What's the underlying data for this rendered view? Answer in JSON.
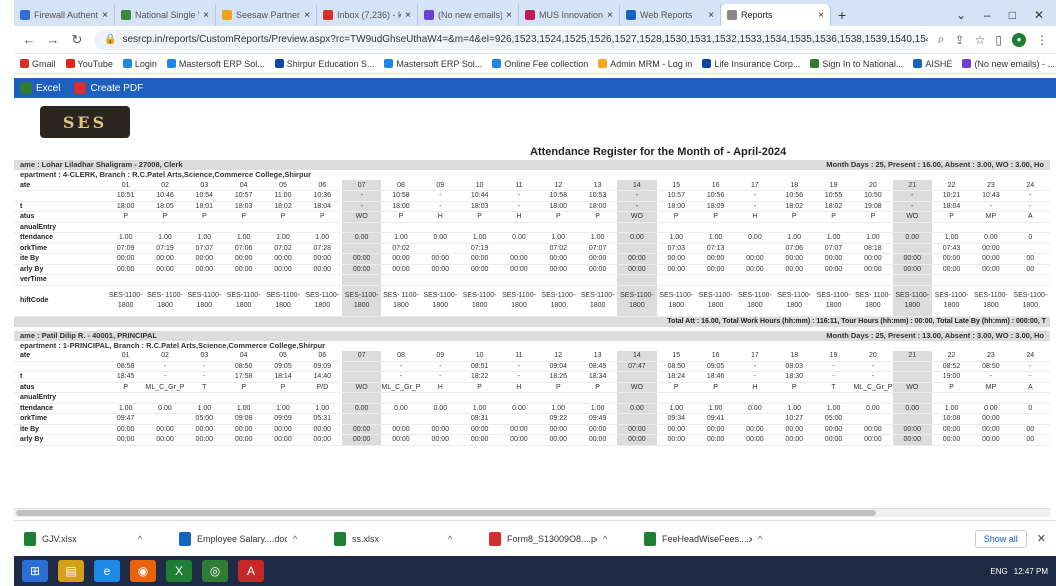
{
  "browser": {
    "tabs": [
      {
        "title": "Firewall Authenticati...",
        "color": "#2c6fd6"
      },
      {
        "title": "National Single Wi...",
        "color": "#3b8a3b"
      },
      {
        "title": "Seesaw Partner Port...",
        "color": "#f2a31b"
      },
      {
        "title": "Inbox (7,236) - kp...",
        "color": "#d93025"
      },
      {
        "title": "(No new emails) - ...",
        "color": "#6b3fd1"
      },
      {
        "title": "MUS Innovation Cell",
        "color": "#c2185b"
      },
      {
        "title": "Web Reports",
        "color": "#1565c0"
      },
      {
        "title": "Reports",
        "color": "#888888",
        "active": true
      }
    ],
    "url": "sesrcp.in/reports/CustomReports/Preview.aspx?rc=TW9udGhseUthaW4=&m=4&el=926,1523,1524,1525,1526,1527,1528,1530,1531,1532,1533,1534,1535,1536,1538,1539,1540,1541,1542,1543,1545,154...",
    "bookmarks": [
      {
        "label": "Gmail",
        "color": "#d93025"
      },
      {
        "label": "YouTube",
        "color": "#e62117"
      },
      {
        "label": "Login",
        "color": "#1e88e5"
      },
      {
        "label": "Mastersoft ERP Sol...",
        "color": "#1e88e5"
      },
      {
        "label": "Shirpur Education S...",
        "color": "#0d47a1"
      },
      {
        "label": "Mastersoft ERP Sol...",
        "color": "#1e88e5"
      },
      {
        "label": "Online Fee collection",
        "color": "#1e88e5"
      },
      {
        "label": "Admin MRM - Log in",
        "color": "#f9a825"
      },
      {
        "label": "Life Insurance Corp...",
        "color": "#0d47a1"
      },
      {
        "label": "Sign In to National...",
        "color": "#2e7d32"
      },
      {
        "label": "AISHE",
        "color": "#1565c0"
      },
      {
        "label": "(No new emails) - ...",
        "color": "#6b3fd1"
      }
    ]
  },
  "toolbar": {
    "excel_label": "Excel",
    "pdf_label": "Create PDF"
  },
  "logo_text": "SES",
  "report_title": "Attendance Register for the Month of - April-2024",
  "days": [
    "01",
    "02",
    "03",
    "04",
    "05",
    "06",
    "07",
    "08",
    "09",
    "10",
    "11",
    "12",
    "13",
    "14",
    "15",
    "16",
    "17",
    "18",
    "19",
    "20",
    "21",
    "22",
    "23",
    "24"
  ],
  "wo_days": [
    6,
    13,
    20
  ],
  "employees": [
    {
      "name": "ame : Lohar Liladhar Shaligram - 27008, Clerk",
      "summary": "Month Days : 25, Present : 16.00, Absent : 3.00, WO : 3.00, Ho",
      "department": "epartment : 4-CLERK, Branch : R.C.Patel Arts,Science,Commerce College,Shirpur",
      "rows": [
        {
          "label": "ate",
          "values": [
            "01",
            "02",
            "03",
            "04",
            "05",
            "06",
            "07",
            "08",
            "09",
            "10",
            "11",
            "12",
            "13",
            "14",
            "15",
            "16",
            "17",
            "18",
            "19",
            "20",
            "21",
            "22",
            "23",
            "24"
          ]
        },
        {
          "label": "",
          "values": [
            "10:51",
            "10:46",
            "10:54",
            "10:57",
            "11:00",
            "10:36",
            "-",
            "10:58",
            "-",
            "10:44",
            "-",
            "10:58",
            "10:53",
            "-",
            "10:57",
            "10:56",
            "-",
            "10:56",
            "10:55",
            "10:50",
            "-",
            "10:21",
            "10:43",
            "-"
          ]
        },
        {
          "label": "t",
          "values": [
            "18:00",
            "18:05",
            "18:01",
            "18:03",
            "18:02",
            "18:04",
            "-",
            "18:00",
            "-",
            "18:03",
            "-",
            "18:00",
            "18:00",
            "-",
            "18:00",
            "18:09",
            "-",
            "18:02",
            "18:02",
            "19:08",
            "-",
            "18:04",
            "-",
            "-"
          ]
        },
        {
          "label": "atus",
          "values": [
            "P",
            "P",
            "P",
            "P",
            "P",
            "P",
            "WO",
            "P",
            "H",
            "P",
            "H",
            "P",
            "P",
            "WO",
            "P",
            "P",
            "H",
            "P",
            "P",
            "P",
            "WO",
            "P",
            "MP",
            "A"
          ]
        },
        {
          "label": "anualEntry",
          "values": [
            "",
            "",
            "",
            "",
            "",
            "",
            "",
            "",
            "",
            "",
            "",
            "",
            "",
            "",
            "",
            "",
            "",
            "",
            "",
            "",
            "",
            "",
            "",
            ""
          ]
        },
        {
          "label": "ttendance",
          "values": [
            "1.00",
            "1.00",
            "1.00",
            "1.00",
            "1.00",
            "1.00",
            "0.00",
            "1.00",
            "0.00",
            "1.00",
            "0.00",
            "1.00",
            "1.00",
            "0.00",
            "1.00",
            "1.00",
            "0.00",
            "1.00",
            "1.00",
            "1.00",
            "0.00",
            "1.00",
            "0.00",
            "0"
          ]
        },
        {
          "label": "orkTime",
          "values": [
            "07:09",
            "07:19",
            "07:07",
            "07:06",
            "07:02",
            "07:28",
            "",
            "07:02",
            "",
            "07:19",
            "",
            "07:02",
            "07:07",
            "",
            "07:03",
            "07:13",
            "",
            "07:06",
            "07:07",
            "08:18",
            "",
            "07:43",
            "00:00",
            ""
          ]
        },
        {
          "label": "ite By",
          "values": [
            "00:00",
            "00:00",
            "00:00",
            "00:00",
            "00:00",
            "00:00",
            "00:00",
            "00:00",
            "00:00",
            "00:00",
            "00:00",
            "00:00",
            "00:00",
            "00:00",
            "00:00",
            "00:00",
            "00:00",
            "00:00",
            "00:00",
            "00:00",
            "00:00",
            "00:00",
            "00:00",
            "00"
          ]
        },
        {
          "label": "arly By",
          "values": [
            "00:00",
            "00:00",
            "00:00",
            "00:00",
            "00:00",
            "00:00",
            "00:00",
            "00:00",
            "00:00",
            "00:00",
            "00:00",
            "00:00",
            "00:00",
            "00:00",
            "00:00",
            "00:00",
            "00:00",
            "00:00",
            "00:00",
            "00:00",
            "00:00",
            "00:00",
            "00:00",
            "00"
          ]
        },
        {
          "label": "verTime",
          "values": [
            "",
            "",
            "",
            "",
            "",
            "",
            "",
            "",
            "",
            "",
            "",
            "",
            "",
            "",
            "",
            "",
            "",
            "",
            "",
            "",
            "",
            "",
            "",
            ""
          ]
        }
      ],
      "shift": [
        "SES-1100-1800",
        "SES- 1100-1800",
        "SES-1100-1800",
        "SES-1100-1800",
        "SES-1100-1800",
        "SES-1100-1800",
        "SES-1100-1800",
        "SES- 1100-1800",
        "SES-1100-1800",
        "SES-1100-1800",
        "SES-1100-1800",
        "SES-1100-1800",
        "SES-1100-1800",
        "SES-1100-1800",
        "SES-1100-1800",
        "SES-1100-1800",
        "SES-1100-1800",
        "SES-1100-1800",
        "SES-1100-1800",
        "SES- 1100-1800",
        "SES-1100-1800",
        "SES-1100-1800",
        "SES-1100-1800",
        "SES-1100-1800"
      ],
      "total": "Total Att : 16.00, Total Work Hours (hh:mm) : 116:11, Tour Hours (hh:mm) : 00:00, Total Late By (hh:mm) : 000:00, T"
    },
    {
      "name": "ame : Patil Dilip R. - 40001, PRINCIPAL",
      "summary": "Month Days : 25, Present : 13.00, Absent : 3.00, WO : 3.00, Ho",
      "department": "epartment : 1-PRINCIPAL, Branch : R.C.Patel Arts,Science,Commerce College,Shirpur",
      "rows": [
        {
          "label": "ate",
          "values": [
            "01",
            "02",
            "03",
            "04",
            "05",
            "06",
            "07",
            "08",
            "09",
            "10",
            "11",
            "12",
            "13",
            "14",
            "15",
            "16",
            "17",
            "18",
            "19",
            "20",
            "21",
            "22",
            "23",
            "24"
          ]
        },
        {
          "label": "",
          "values": [
            "08:58",
            "-",
            "-",
            "08:50",
            "09:05",
            "09:09",
            "",
            "-",
            "-",
            "08:51",
            "-",
            "09:04",
            "08:45",
            "07:47",
            "08:50",
            "09:05",
            "-",
            "08:03",
            "-",
            "-",
            "",
            "08:52",
            "08:50",
            "-"
          ]
        },
        {
          "label": "t",
          "values": [
            "18:45",
            "-",
            "-",
            "17:58",
            "18:14",
            "14:40",
            "",
            "-",
            "-",
            "18:22",
            "-",
            "18:26",
            "18:34",
            "",
            "18:24",
            "18:46",
            "-",
            "18:30",
            "-",
            "-",
            "",
            "19:00",
            "-",
            "-"
          ]
        },
        {
          "label": "atus",
          "values": [
            "P",
            "ML_C_Gr_P",
            "T",
            "P",
            "P",
            "P/D",
            "WO",
            "ML_C_Gr_P",
            "H",
            "P",
            "H",
            "P",
            "P",
            "WO",
            "P",
            "P",
            "H",
            "P",
            "T",
            "ML_C_Gr_P",
            "WO",
            "P",
            "MP",
            "A"
          ]
        },
        {
          "label": "anualEntry",
          "values": [
            "",
            "",
            "",
            "",
            "",
            "",
            "",
            "",
            "",
            "",
            "",
            "",
            "",
            "",
            "",
            "",
            "",
            "",
            "",
            "",
            "",
            "",
            "",
            ""
          ]
        },
        {
          "label": "ttendance",
          "values": [
            "1.00",
            "0.00",
            "1.00",
            "1.00",
            "1.00",
            "1.00",
            "0.00",
            "0.00",
            "0.00",
            "1.00",
            "0.00",
            "1.00",
            "1.00",
            "0.00",
            "1.00",
            "1.00",
            "0.00",
            "1.00",
            "1.00",
            "0.00",
            "0.00",
            "1.00",
            "0.00",
            "0"
          ]
        },
        {
          "label": "orkTime",
          "values": [
            "09:47",
            "",
            "05:00",
            "09:08",
            "09:09",
            "05:31",
            "",
            "",
            "",
            "09:31",
            "",
            "09:22",
            "09:49",
            "",
            "09:34",
            "09:41",
            "",
            "10:27",
            "05:00",
            "",
            "",
            "10:08",
            "00:00",
            ""
          ]
        },
        {
          "label": "ite By",
          "values": [
            "00:00",
            "00:00",
            "00:00",
            "00:00",
            "00:00",
            "00:00",
            "00:00",
            "00:00",
            "00:00",
            "00:00",
            "00:00",
            "00:00",
            "00:00",
            "00:00",
            "00:00",
            "00:00",
            "00:00",
            "00:00",
            "00:00",
            "00:00",
            "00:00",
            "00:00",
            "00:00",
            "00"
          ]
        },
        {
          "label": "arly By",
          "values": [
            "00:00",
            "00:00",
            "00:00",
            "00:00",
            "00:00",
            "00:00",
            "00:00",
            "00:00",
            "00:00",
            "00:00",
            "00:00",
            "00:00",
            "00:00",
            "00:00",
            "00:00",
            "00:00",
            "00:00",
            "00:00",
            "00:00",
            "00:00",
            "00:00",
            "00:00",
            "00:00",
            "00"
          ]
        }
      ]
    }
  ],
  "downloads": [
    {
      "name": "GJV.xlsx",
      "color": "#1e7e34"
    },
    {
      "name": "Employee Salary....docx",
      "color": "#1565c0"
    },
    {
      "name": "ss.xlsx",
      "color": "#1e7e34"
    },
    {
      "name": "Form8_S13009O8....pdf",
      "color": "#d32f2f"
    },
    {
      "name": "FeeHeadWiseFees....xlsx",
      "color": "#1e7e34"
    }
  ],
  "show_all_label": "Show all",
  "taskbar": {
    "apps": [
      {
        "name": "windows-start",
        "color": "#2b6fd6",
        "glyph": "⊞"
      },
      {
        "name": "explorer",
        "color": "#d4a017",
        "glyph": "▤"
      },
      {
        "name": "ie",
        "color": "#1e88e5",
        "glyph": "e"
      },
      {
        "name": "firefox",
        "color": "#e8630a",
        "glyph": "◉"
      },
      {
        "name": "excel",
        "color": "#1e7e34",
        "glyph": "X"
      },
      {
        "name": "chrome",
        "color": "#2e7d32",
        "glyph": "◎"
      },
      {
        "name": "acrobat",
        "color": "#c62828",
        "glyph": "A"
      }
    ],
    "lang": "ENG",
    "time": "12:47 PM"
  }
}
